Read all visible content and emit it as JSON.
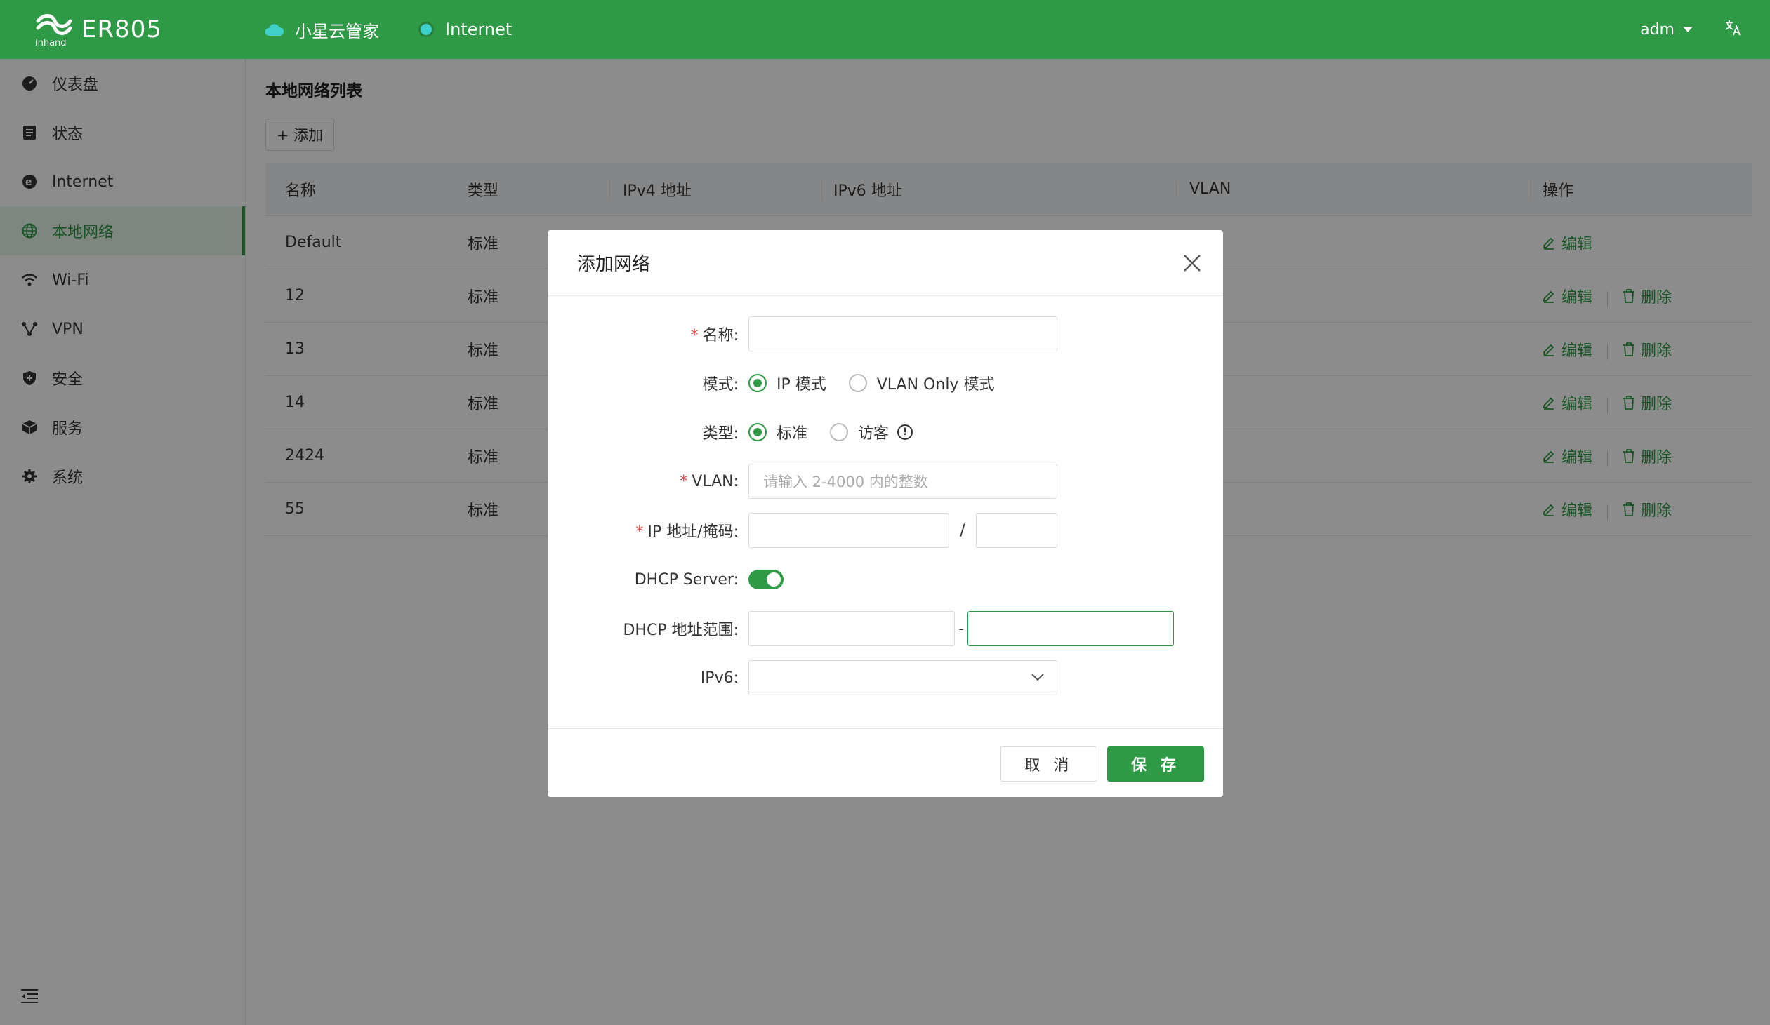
{
  "header": {
    "product": "ER805",
    "nav": [
      {
        "label": "小星云管家",
        "icon": "cloud-icon"
      },
      {
        "label": "Internet",
        "icon": "status-dot-icon"
      }
    ],
    "user": "adm",
    "brand_color": "#2e9a45"
  },
  "sidebar": {
    "items": [
      {
        "label": "仪表盘",
        "icon": "dashboard-icon"
      },
      {
        "label": "状态",
        "icon": "status-icon"
      },
      {
        "label": "Internet",
        "icon": "internet-icon"
      },
      {
        "label": "本地网络",
        "icon": "globe-icon",
        "active": true
      },
      {
        "label": "Wi-Fi",
        "icon": "wifi-icon"
      },
      {
        "label": "VPN",
        "icon": "vpn-icon"
      },
      {
        "label": "安全",
        "icon": "shield-icon"
      },
      {
        "label": "服务",
        "icon": "box-icon"
      },
      {
        "label": "系统",
        "icon": "gear-icon"
      }
    ]
  },
  "main": {
    "title": "本地网络列表",
    "add_label": "+ 添加",
    "columns": [
      "名称",
      "类型",
      "IPv4 地址",
      "IPv6 地址",
      "VLAN",
      "操作"
    ],
    "rows": [
      {
        "name": "Default",
        "type": "标准",
        "deletable": false
      },
      {
        "name": "12",
        "type": "标准",
        "deletable": true
      },
      {
        "name": "13",
        "type": "标准",
        "deletable": true
      },
      {
        "name": "14",
        "type": "标准",
        "deletable": true
      },
      {
        "name": "2424",
        "type": "标准",
        "deletable": true
      },
      {
        "name": "55",
        "type": "标准",
        "deletable": true
      }
    ],
    "edit_label": "编辑",
    "delete_label": "删除"
  },
  "modal": {
    "title": "添加网络",
    "fields": {
      "name_label": "名称:",
      "mode_label": "模式:",
      "mode_options": [
        "IP 模式",
        "VLAN Only 模式"
      ],
      "type_label": "类型:",
      "type_options": [
        "标准",
        "访客"
      ],
      "vlan_label": "VLAN:",
      "vlan_placeholder": "请输入 2-4000 内的整数",
      "ip_label": "IP 地址/掩码:",
      "ip_sep": "/",
      "dhcp_server_label": "DHCP Server:",
      "dhcp_range_label": "DHCP 地址范围:",
      "dhcp_range_sep": "-",
      "ipv6_label": "IPv6:"
    },
    "cancel_label": "取 消",
    "save_label": "保 存"
  }
}
